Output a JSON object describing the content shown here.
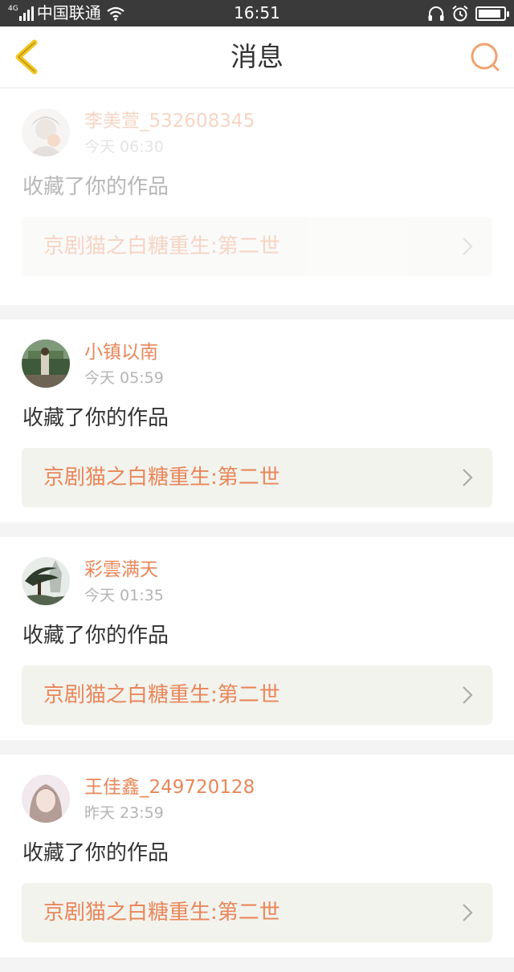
{
  "status_bar": {
    "network_type": "4G",
    "carrier": "中国联通",
    "time": "16:51",
    "battery_level": 0.9
  },
  "nav": {
    "title": "消息",
    "back_icon": "chevron-left-icon",
    "search_icon": "search-icon",
    "accent_color": "#f0a26e",
    "back_color": "#f2c521"
  },
  "messages": [
    {
      "username": "李美萱_532608345",
      "time": "今天 06:30",
      "action": "收藏了你的作品",
      "work_title": "京剧猫之白糖重生:第二世",
      "avatar_icon": "avatar-anime-girl",
      "faded": true
    },
    {
      "username": "小镇以南",
      "time": "今天 05:59",
      "action": "收藏了你的作品",
      "work_title": "京剧猫之白糖重生:第二世",
      "avatar_icon": "avatar-photo-outdoor"
    },
    {
      "username": "彩雲满天",
      "time": "今天 01:35",
      "action": "收藏了你的作品",
      "work_title": "京剧猫之白糖重生:第二世",
      "avatar_icon": "avatar-pine-landscape"
    },
    {
      "username": "王佳鑫_249720128",
      "time": "昨天 23:59",
      "action": "收藏了你的作品",
      "work_title": "京剧猫之白糖重生:第二世",
      "avatar_icon": "avatar-portrait-girl"
    }
  ],
  "colors": {
    "username": "#e8875a",
    "link_bg": "#f3f3ee",
    "status_bar_bg": "#3a3a3a"
  }
}
